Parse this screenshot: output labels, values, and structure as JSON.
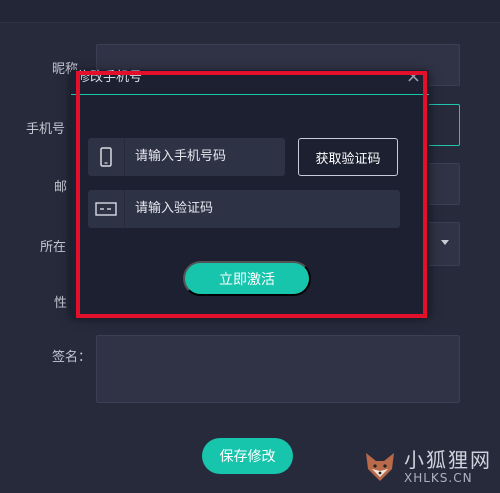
{
  "form": {
    "nickname_label": "昵称",
    "phone_label": "手机号",
    "email_label": "邮",
    "location_label": "所在",
    "gender_label": "性",
    "signature_label": "签名："
  },
  "save_button": "保存修改",
  "dialog": {
    "title": "修改手机号",
    "close": "×",
    "phone_placeholder": "请输入手机号码",
    "code_placeholder": "请输入验证码",
    "get_code_button": "获取验证码",
    "activate_button": "立即激活"
  },
  "watermark": {
    "main": "小狐狸网",
    "sub": "XHLKS.CN"
  },
  "colors": {
    "accent": "#17c5ad",
    "highlight": "#e2102a"
  }
}
